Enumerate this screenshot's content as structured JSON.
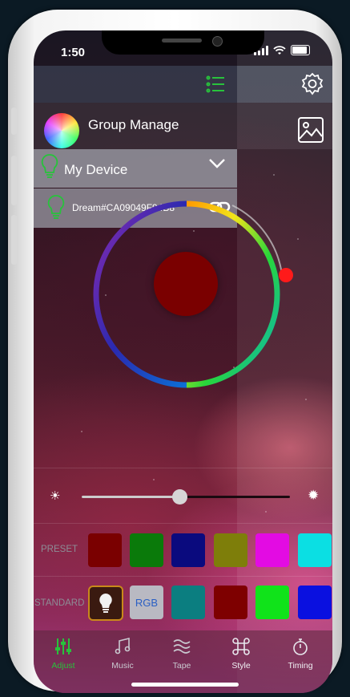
{
  "status_bar": {
    "time": "1:50"
  },
  "header": {
    "list_icon": "list-icon",
    "settings_icon": "gear-icon"
  },
  "group": {
    "label": "Group Manage",
    "image_icon": "image-icon"
  },
  "device_group": {
    "label": "My Device",
    "expanded": true
  },
  "device": {
    "name": "Dream#CA09049F94B8",
    "link_icon": "link-icon"
  },
  "color_picker": {
    "selected_color": "#7a0000",
    "thumb_color": "#ff1a1a"
  },
  "brightness": {
    "level_percent": 47,
    "min_icon": "sun-dim-icon",
    "max_icon": "sun-bright-icon"
  },
  "preset": {
    "label": "PRESET",
    "colors": [
      "#7a0000",
      "#0a7a0a",
      "#0a0a7e",
      "#7e7e0a",
      "#e30be3",
      "#0bdfe3"
    ]
  },
  "standard": {
    "label": "STANDARD",
    "rgb_label": "RGB",
    "colors": [
      "#0b7e80",
      "#7e0000",
      "#10e31a",
      "#0a10e0"
    ]
  },
  "tabs": [
    {
      "label": "Adjust",
      "icon": "sliders-icon",
      "active": true
    },
    {
      "label": "Music",
      "icon": "music-icon",
      "active": false
    },
    {
      "label": "Tape",
      "icon": "tape-icon",
      "active": false
    },
    {
      "label": "Style",
      "icon": "command-icon",
      "active": false
    },
    {
      "label": "Timing",
      "icon": "stopwatch-icon",
      "active": false
    }
  ],
  "colors": {
    "accent_green": "#28c23c",
    "bulb_outline": "#c8891a"
  }
}
